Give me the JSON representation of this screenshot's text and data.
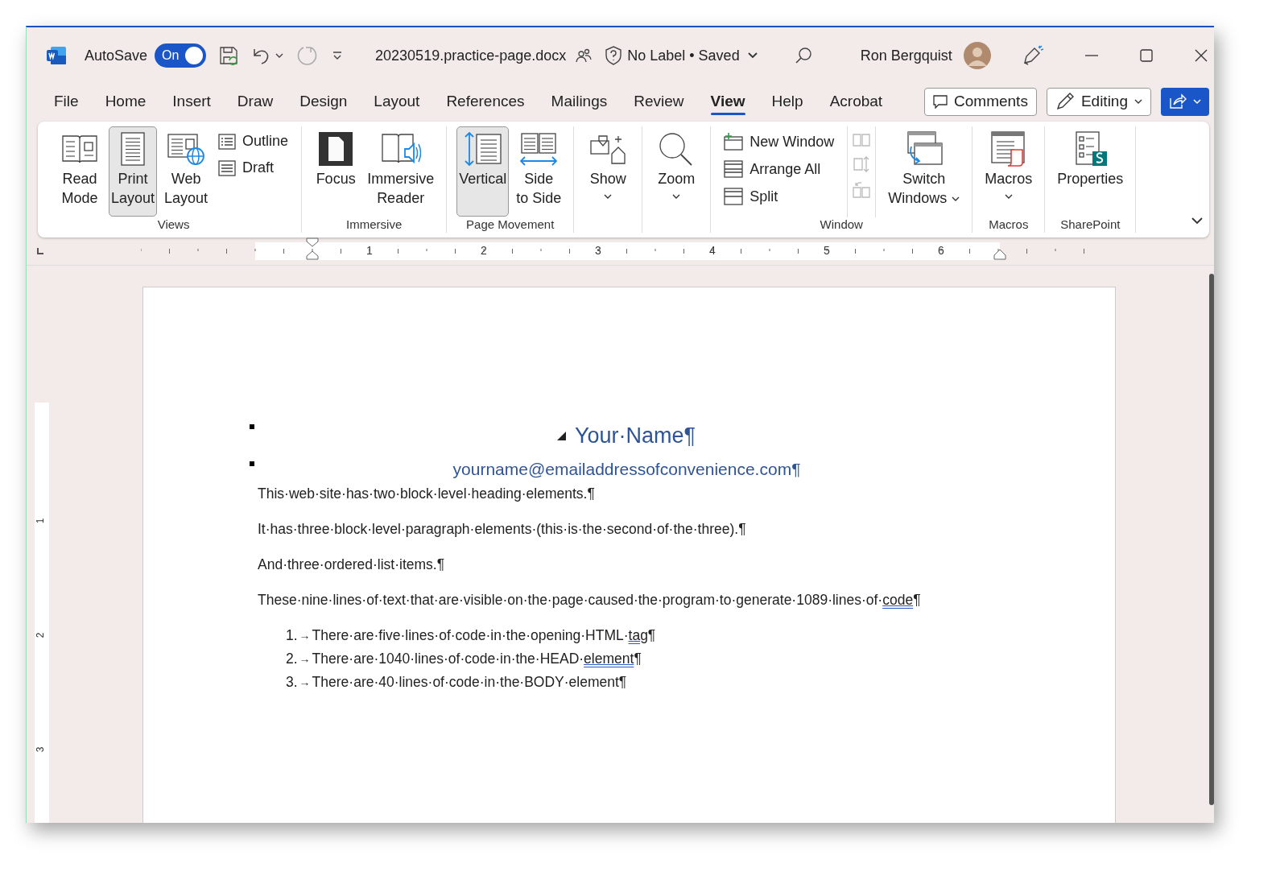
{
  "title_bar": {
    "autosave": {
      "label": "AutoSave",
      "on": true,
      "state_text": "On"
    },
    "filename": "20230519.practice-page.docx",
    "status": "No Label • Saved",
    "user": "Ron Bergquist"
  },
  "tabs": [
    {
      "label": "File",
      "selected": false
    },
    {
      "label": "Home",
      "selected": false
    },
    {
      "label": "Insert",
      "selected": false
    },
    {
      "label": "Draw",
      "selected": false
    },
    {
      "label": "Design",
      "selected": false
    },
    {
      "label": "Layout",
      "selected": false
    },
    {
      "label": "References",
      "selected": false
    },
    {
      "label": "Mailings",
      "selected": false
    },
    {
      "label": "Review",
      "selected": false
    },
    {
      "label": "View",
      "selected": true
    },
    {
      "label": "Help",
      "selected": false
    },
    {
      "label": "Acrobat",
      "selected": false
    }
  ],
  "actions": {
    "comments": "Comments",
    "editing": "Editing"
  },
  "ribbon": {
    "groups": [
      {
        "name": "Views",
        "items": [
          {
            "kind": "large",
            "lines": [
              "Read",
              "Mode"
            ],
            "selected": false,
            "menu": false
          },
          {
            "kind": "large",
            "lines": [
              "Print",
              "Layout"
            ],
            "selected": true,
            "menu": false
          },
          {
            "kind": "large",
            "lines": [
              "Web",
              "Layout"
            ],
            "selected": false,
            "menu": false
          },
          {
            "kind": "small",
            "label": "Outline",
            "disabled": false
          },
          {
            "kind": "small",
            "label": "Draft",
            "disabled": false
          }
        ]
      },
      {
        "name": "Immersive",
        "items": [
          {
            "kind": "large",
            "lines": [
              "Focus"
            ],
            "selected": false,
            "menu": false
          },
          {
            "kind": "large",
            "lines": [
              "Immersive",
              "Reader"
            ],
            "selected": false,
            "menu": false
          }
        ]
      },
      {
        "name": "Page Movement",
        "items": [
          {
            "kind": "large",
            "lines": [
              "Vertical"
            ],
            "selected": true,
            "menu": false
          },
          {
            "kind": "large",
            "lines": [
              "Side",
              "to Side"
            ],
            "selected": false,
            "menu": false
          }
        ]
      },
      {
        "items": [
          {
            "kind": "large",
            "lines": [
              "Show"
            ],
            "selected": false,
            "menu": true
          }
        ]
      },
      {
        "items": [
          {
            "kind": "large",
            "lines": [
              "Zoom"
            ],
            "selected": false,
            "menu": true
          }
        ]
      },
      {
        "name": "Window",
        "items": [
          {
            "kind": "small",
            "label": "New Window",
            "disabled": false
          },
          {
            "kind": "small",
            "label": "Arrange All",
            "disabled": false
          },
          {
            "kind": "small",
            "label": "Split",
            "disabled": false
          },
          {
            "kind": "icon",
            "disabled": true
          },
          {
            "kind": "icon",
            "disabled": true
          },
          {
            "kind": "icon",
            "disabled": true
          },
          {
            "kind": "large",
            "lines": [
              "Switch",
              "Windows"
            ],
            "selected": false,
            "menu": true
          }
        ]
      },
      {
        "name": "Macros",
        "items": [
          {
            "kind": "large",
            "lines": [
              "Macros"
            ],
            "selected": false,
            "menu": true
          }
        ]
      },
      {
        "name": "SharePoint",
        "items": [
          {
            "kind": "large",
            "lines": [
              "Properties"
            ],
            "selected": false,
            "menu": false
          }
        ]
      }
    ]
  },
  "ruler": {
    "marks": [
      "1",
      "2",
      "3",
      "4",
      "5",
      "6"
    ]
  },
  "vertical_ruler": {
    "marks": [
      "1",
      "2",
      "3"
    ]
  },
  "document": {
    "heading": "Your·Name¶",
    "email": "yourname@emailaddressofconvenience.com¶",
    "paragraphs": [
      [
        {
          "text": "This·web·site·has·two·block·level·heading·elements.¶",
          "flagged": false
        }
      ],
      [
        {
          "text": "It·has·three·block·level·paragraph·elements·(this·is·the·second·of·the·three).¶",
          "flagged": false
        }
      ],
      [
        {
          "text": "And·three·ordered·list·items.¶",
          "flagged": false
        }
      ],
      [
        {
          "text": "These·nine·lines·of·text·that·are·visible·on·the·page·caused·the·program·to·generate·1089·lines·of·",
          "flagged": false
        },
        {
          "text": "code",
          "flagged": true
        },
        {
          "text": "¶",
          "flagged": false
        }
      ]
    ],
    "list": [
      {
        "number": "1.",
        "tab": "→",
        "segments": [
          {
            "text": "There·are·five·lines·of·code·in·the·opening·HTML·",
            "flagged": false
          },
          {
            "text": "tag",
            "flagged": true
          },
          {
            "text": "¶",
            "flagged": false
          }
        ]
      },
      {
        "number": "2.",
        "tab": "→",
        "segments": [
          {
            "text": "There·are·1040·lines·of·code·in·the·HEAD·",
            "flagged": false
          },
          {
            "text": "element",
            "flagged": true
          },
          {
            "text": "¶",
            "flagged": false
          }
        ]
      },
      {
        "number": "3.",
        "tab": "→",
        "segments": [
          {
            "text": "There·are·40·lines·of·code·in·the·BODY·element¶",
            "flagged": false
          }
        ]
      }
    ]
  }
}
